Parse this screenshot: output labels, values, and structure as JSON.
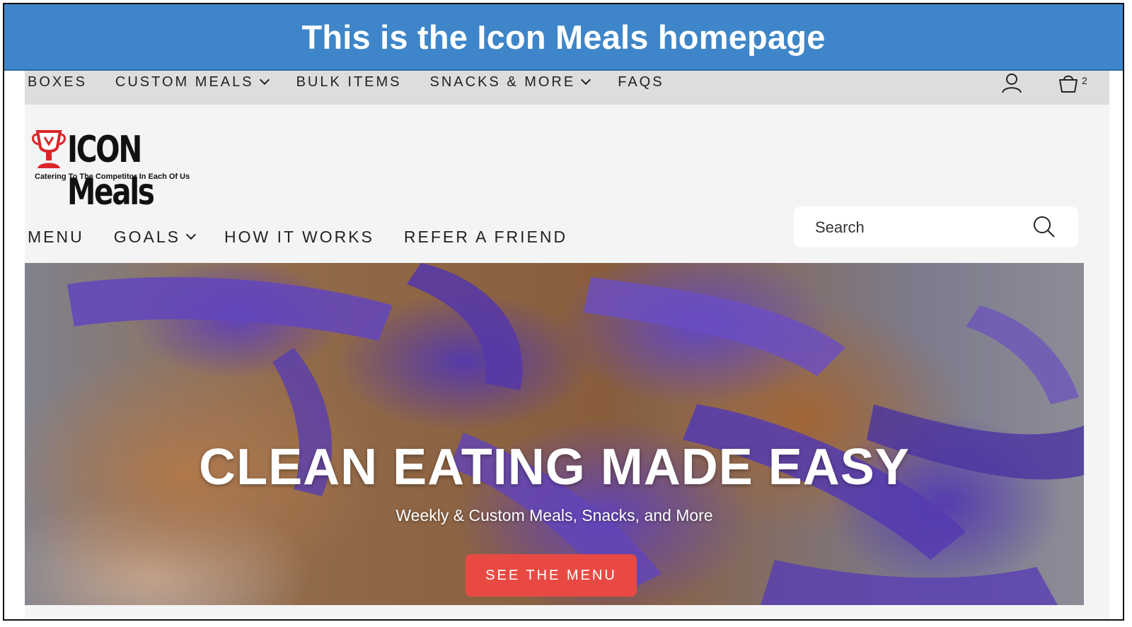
{
  "banner": {
    "title": "This is the Icon Meals homepage"
  },
  "topnav": {
    "items": [
      {
        "label": "BOXES",
        "dropdown": false
      },
      {
        "label": "CUSTOM MEALS",
        "dropdown": true
      },
      {
        "label": "BULK ITEMS",
        "dropdown": false
      },
      {
        "label": "SNACKS & MORE",
        "dropdown": true
      },
      {
        "label": "FAQS",
        "dropdown": false
      }
    ],
    "account_icon": "user-icon",
    "cart_icon": "cart-icon",
    "cart_count": "2"
  },
  "logo": {
    "name": "ICON Meals",
    "tagline": "Catering To The Competitor In Each Of Us",
    "icon": "trophy-icon"
  },
  "mainnav": {
    "items": [
      {
        "label": "MENU",
        "dropdown": false
      },
      {
        "label": "GOALS",
        "dropdown": true
      },
      {
        "label": "HOW IT WORKS",
        "dropdown": false
      },
      {
        "label": "REFER A FRIEND",
        "dropdown": false
      }
    ]
  },
  "search": {
    "placeholder": "Search",
    "value": "",
    "icon": "search-icon"
  },
  "hero": {
    "title": "CLEAN EATING MADE EASY",
    "subtitle": "Weekly & Custom Meals, Snacks, and More",
    "cta_label": "SEE THE MENU"
  },
  "colors": {
    "banner_bg": "#3e86c9",
    "cta_bg": "#e84a43",
    "topbar_bg": "#dddddd",
    "header_bg": "#f4f4f4",
    "logo_red": "#d9262b"
  }
}
